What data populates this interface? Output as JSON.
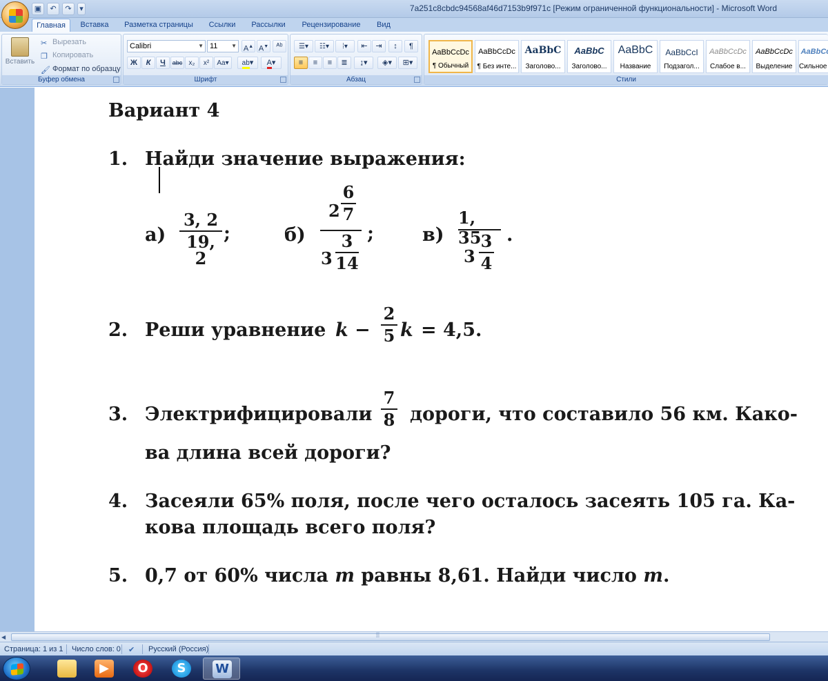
{
  "window": {
    "title": "7a251c8cbdc94568af46d7153b9f971c [Режим ограниченной функциональности] - Microsoft Word"
  },
  "tabs": [
    "Главная",
    "Вставка",
    "Разметка страницы",
    "Ссылки",
    "Рассылки",
    "Рецензирование",
    "Вид"
  ],
  "ribbon": {
    "clipboard": {
      "paste_label": "Вставить",
      "cut_label": "Вырезать",
      "copy_label": "Копировать",
      "format_painter_label": "Формат по образцу",
      "group_label": "Буфер обмена"
    },
    "font": {
      "font_name": "Calibri",
      "font_size": "11",
      "group_label": "Шрифт"
    },
    "paragraph": {
      "group_label": "Абзац"
    },
    "styles": {
      "group_label": "Стили",
      "items": [
        {
          "sample": "AaBbCcDc",
          "name": "¶ Обычный"
        },
        {
          "sample": "AaBbCcDc",
          "name": "¶ Без инте..."
        },
        {
          "sample": "AaBbC",
          "name": "Заголово..."
        },
        {
          "sample": "AaBbC",
          "name": "Заголово..."
        },
        {
          "sample": "AaBbC",
          "name": "Название"
        },
        {
          "sample": "AaBbCcI",
          "name": "Подзагол..."
        },
        {
          "sample": "AaBbCcDc",
          "name": "Слабое в..."
        },
        {
          "sample": "AaBbCcDc",
          "name": "Выделение"
        },
        {
          "sample": "AaBbCc",
          "name": "Сильное ..."
        }
      ]
    }
  },
  "document": {
    "heading": "Вариант 4",
    "q1": {
      "num": "1.",
      "text": "Найди значение выражения:",
      "a_label": "а)",
      "a_num": "3, 2",
      "a_den": "19, 2",
      "a_end": ";",
      "b_label": "б)",
      "b_top_whole": "2",
      "b_top_num": "6",
      "b_top_den": "7",
      "b_bot_whole": "3",
      "b_bot_num": "3",
      "b_bot_den": "14",
      "b_end": ";",
      "c_label": "в)",
      "c_num": "1, 35",
      "c_bot_whole": "3",
      "c_bot_num": "3",
      "c_bot_den": "4",
      "c_end": "."
    },
    "q2": {
      "num": "2.",
      "text": "Реши уравнение",
      "var1": "k",
      "minus": "−",
      "frac_num": "2",
      "frac_den": "5",
      "var2": "k",
      "rest": "= 4,5."
    },
    "q3": {
      "num": "3.",
      "text_before": "Электрифицировали",
      "frac_num": "7",
      "frac_den": "8",
      "text_after": "дороги, что составило 56 км. Како-",
      "line2": "ва длина всей дороги?"
    },
    "q4": {
      "num": "4.",
      "line1": "Засеяли 65% поля, после чего осталось засеять 105 га. Ка-",
      "line2": "кова площадь всего поля?"
    },
    "q5": {
      "num": "5.",
      "part1": "0,7 от 60% числа",
      "var1": "m",
      "part2": "равны 8,61. Найди число",
      "var2": "m",
      "end": "."
    }
  },
  "status": {
    "page": "Страница: 1 из 1",
    "words": "Число слов: 0",
    "language": "Русский (Россия)"
  },
  "taskbar": {
    "apps": [
      "explorer-icon",
      "media-player-icon",
      "opera-icon",
      "skype-icon",
      "word-icon"
    ]
  }
}
